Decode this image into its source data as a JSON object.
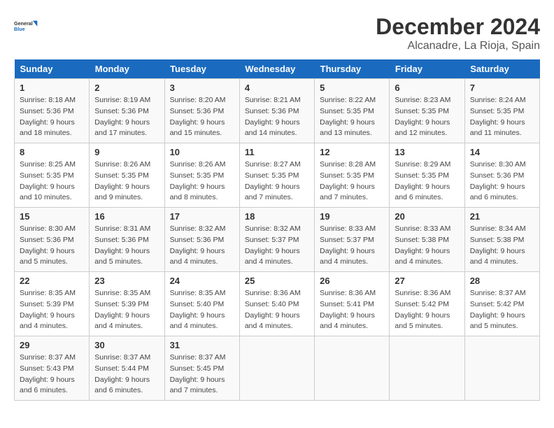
{
  "header": {
    "logo_line1": "General",
    "logo_line2": "Blue",
    "month": "December 2024",
    "location": "Alcanadre, La Rioja, Spain"
  },
  "weekdays": [
    "Sunday",
    "Monday",
    "Tuesday",
    "Wednesday",
    "Thursday",
    "Friday",
    "Saturday"
  ],
  "weeks": [
    [
      {
        "day": "1",
        "sunrise": "8:18 AM",
        "sunset": "5:36 PM",
        "daylight": "9 hours and 18 minutes."
      },
      {
        "day": "2",
        "sunrise": "8:19 AM",
        "sunset": "5:36 PM",
        "daylight": "9 hours and 17 minutes."
      },
      {
        "day": "3",
        "sunrise": "8:20 AM",
        "sunset": "5:36 PM",
        "daylight": "9 hours and 15 minutes."
      },
      {
        "day": "4",
        "sunrise": "8:21 AM",
        "sunset": "5:36 PM",
        "daylight": "9 hours and 14 minutes."
      },
      {
        "day": "5",
        "sunrise": "8:22 AM",
        "sunset": "5:35 PM",
        "daylight": "9 hours and 13 minutes."
      },
      {
        "day": "6",
        "sunrise": "8:23 AM",
        "sunset": "5:35 PM",
        "daylight": "9 hours and 12 minutes."
      },
      {
        "day": "7",
        "sunrise": "8:24 AM",
        "sunset": "5:35 PM",
        "daylight": "9 hours and 11 minutes."
      }
    ],
    [
      {
        "day": "8",
        "sunrise": "8:25 AM",
        "sunset": "5:35 PM",
        "daylight": "9 hours and 10 minutes."
      },
      {
        "day": "9",
        "sunrise": "8:26 AM",
        "sunset": "5:35 PM",
        "daylight": "9 hours and 9 minutes."
      },
      {
        "day": "10",
        "sunrise": "8:26 AM",
        "sunset": "5:35 PM",
        "daylight": "9 hours and 8 minutes."
      },
      {
        "day": "11",
        "sunrise": "8:27 AM",
        "sunset": "5:35 PM",
        "daylight": "9 hours and 7 minutes."
      },
      {
        "day": "12",
        "sunrise": "8:28 AM",
        "sunset": "5:35 PM",
        "daylight": "9 hours and 7 minutes."
      },
      {
        "day": "13",
        "sunrise": "8:29 AM",
        "sunset": "5:35 PM",
        "daylight": "9 hours and 6 minutes."
      },
      {
        "day": "14",
        "sunrise": "8:30 AM",
        "sunset": "5:36 PM",
        "daylight": "9 hours and 6 minutes."
      }
    ],
    [
      {
        "day": "15",
        "sunrise": "8:30 AM",
        "sunset": "5:36 PM",
        "daylight": "9 hours and 5 minutes."
      },
      {
        "day": "16",
        "sunrise": "8:31 AM",
        "sunset": "5:36 PM",
        "daylight": "9 hours and 5 minutes."
      },
      {
        "day": "17",
        "sunrise": "8:32 AM",
        "sunset": "5:36 PM",
        "daylight": "9 hours and 4 minutes."
      },
      {
        "day": "18",
        "sunrise": "8:32 AM",
        "sunset": "5:37 PM",
        "daylight": "9 hours and 4 minutes."
      },
      {
        "day": "19",
        "sunrise": "8:33 AM",
        "sunset": "5:37 PM",
        "daylight": "9 hours and 4 minutes."
      },
      {
        "day": "20",
        "sunrise": "8:33 AM",
        "sunset": "5:38 PM",
        "daylight": "9 hours and 4 minutes."
      },
      {
        "day": "21",
        "sunrise": "8:34 AM",
        "sunset": "5:38 PM",
        "daylight": "9 hours and 4 minutes."
      }
    ],
    [
      {
        "day": "22",
        "sunrise": "8:35 AM",
        "sunset": "5:39 PM",
        "daylight": "9 hours and 4 minutes."
      },
      {
        "day": "23",
        "sunrise": "8:35 AM",
        "sunset": "5:39 PM",
        "daylight": "9 hours and 4 minutes."
      },
      {
        "day": "24",
        "sunrise": "8:35 AM",
        "sunset": "5:40 PM",
        "daylight": "9 hours and 4 minutes."
      },
      {
        "day": "25",
        "sunrise": "8:36 AM",
        "sunset": "5:40 PM",
        "daylight": "9 hours and 4 minutes."
      },
      {
        "day": "26",
        "sunrise": "8:36 AM",
        "sunset": "5:41 PM",
        "daylight": "9 hours and 4 minutes."
      },
      {
        "day": "27",
        "sunrise": "8:36 AM",
        "sunset": "5:42 PM",
        "daylight": "9 hours and 5 minutes."
      },
      {
        "day": "28",
        "sunrise": "8:37 AM",
        "sunset": "5:42 PM",
        "daylight": "9 hours and 5 minutes."
      }
    ],
    [
      {
        "day": "29",
        "sunrise": "8:37 AM",
        "sunset": "5:43 PM",
        "daylight": "9 hours and 6 minutes."
      },
      {
        "day": "30",
        "sunrise": "8:37 AM",
        "sunset": "5:44 PM",
        "daylight": "9 hours and 6 minutes."
      },
      {
        "day": "31",
        "sunrise": "8:37 AM",
        "sunset": "5:45 PM",
        "daylight": "9 hours and 7 minutes."
      },
      null,
      null,
      null,
      null
    ]
  ],
  "labels": {
    "sunrise": "Sunrise:",
    "sunset": "Sunset:",
    "daylight": "Daylight:"
  }
}
